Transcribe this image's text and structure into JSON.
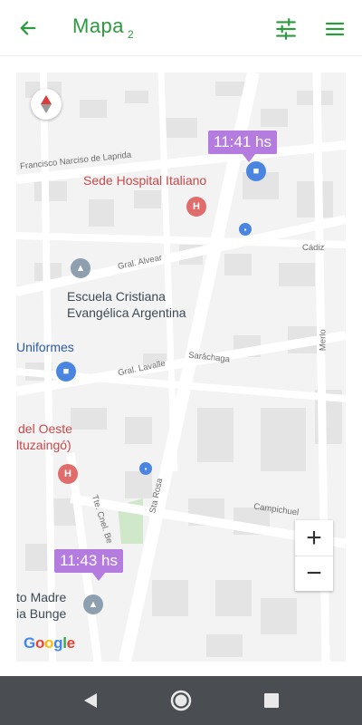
{
  "app": {
    "title": "Mapa",
    "title_sub": "2",
    "accent": "#2e9a3f"
  },
  "icons": {
    "back": "arrow-left-icon",
    "filter": "sliders-icon",
    "menu": "hamburger-menu-icon",
    "compass": "compass-icon"
  },
  "map": {
    "places": {
      "hospital_italiano": "Sede Hospital Italiano",
      "escuela_line1": "Escuela Cristiana",
      "escuela_line2": "Evangélica Argentina",
      "uniformes": "Uniformes",
      "del_oeste_line1": "del Oeste",
      "del_oeste_line2": "ltuzaingó)",
      "madre_line1": "to Madre",
      "madre_line2": "ia Bunge"
    },
    "streets": {
      "laprida": "Francisco Narciso de Laprida",
      "alvear": "Gral. Alvear",
      "cadiz": "Cádiz",
      "lavalle": "Gral. Lavalle",
      "sarachaga": "Saráchaga",
      "merlo": "Merlo",
      "sta_rosa": "Sta Rosa",
      "chel_be": "Tte. Cnel. Be",
      "campichuelo": "Campichuel"
    },
    "badges": [
      {
        "time": "11:41 hs"
      },
      {
        "time": "11:43 hs"
      }
    ],
    "badge_color": "#b57ce0",
    "zoom_in": "+",
    "zoom_out": "−",
    "attribution": "Google"
  },
  "navbar": {
    "back": "nav-back-icon",
    "home": "nav-home-icon",
    "recents": "nav-recents-icon"
  }
}
